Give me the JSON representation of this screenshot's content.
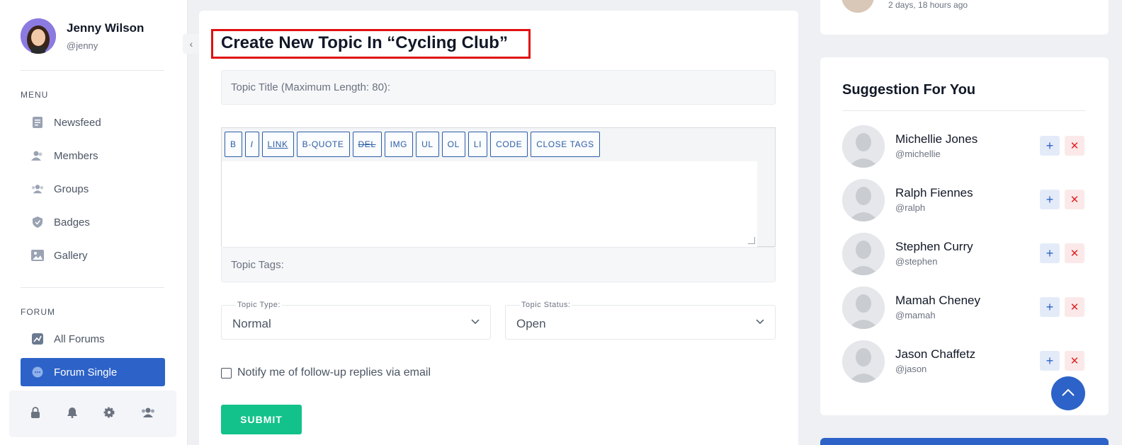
{
  "profile": {
    "name": "Jenny Wilson",
    "handle": "@jenny"
  },
  "menu": {
    "label": "MENU",
    "items": [
      {
        "label": "Newsfeed",
        "icon": "newsfeed-icon"
      },
      {
        "label": "Members",
        "icon": "members-icon"
      },
      {
        "label": "Groups",
        "icon": "groups-icon"
      },
      {
        "label": "Badges",
        "icon": "badge-icon"
      },
      {
        "label": "Gallery",
        "icon": "gallery-icon"
      }
    ]
  },
  "forum": {
    "label": "FORUM",
    "items": [
      {
        "label": "All Forums",
        "icon": "chart-icon"
      },
      {
        "label": "Forum Single",
        "icon": "chat-icon",
        "active": true
      }
    ]
  },
  "bottom_icons": [
    "lock-icon",
    "bell-icon",
    "gear-icon",
    "users-icon"
  ],
  "form": {
    "title": "Create New Topic In “Cycling Club”",
    "topic_title_placeholder": "Topic Title (Maximum Length: 80):",
    "toolbar": [
      "B",
      "I",
      "LINK",
      "B-QUOTE",
      "DEL",
      "IMG",
      "UL",
      "OL",
      "LI",
      "CODE",
      "CLOSE TAGS"
    ],
    "tags_placeholder": "Topic Tags:",
    "type_label": "Topic Type:",
    "type_value": "Normal",
    "status_label": "Topic Status:",
    "status_value": "Open",
    "notify_label": "Notify me of follow-up replies via email",
    "submit_label": "SUBMIT"
  },
  "top_card": {
    "time": "2 days, 18 hours ago"
  },
  "suggestions": {
    "title": "Suggestion For You",
    "people": [
      {
        "name": "Michellie Jones",
        "handle": "@michellie"
      },
      {
        "name": "Ralph Fiennes",
        "handle": "@ralph"
      },
      {
        "name": "Stephen Curry",
        "handle": "@stephen"
      },
      {
        "name": "Mamah Cheney",
        "handle": "@mamah"
      },
      {
        "name": "Jason Chaffetz",
        "handle": "@jason"
      }
    ]
  },
  "colors": {
    "accent": "#2d63c8",
    "submit": "#12c28a",
    "danger": "#e02424",
    "highlight_box": "#e01010"
  }
}
